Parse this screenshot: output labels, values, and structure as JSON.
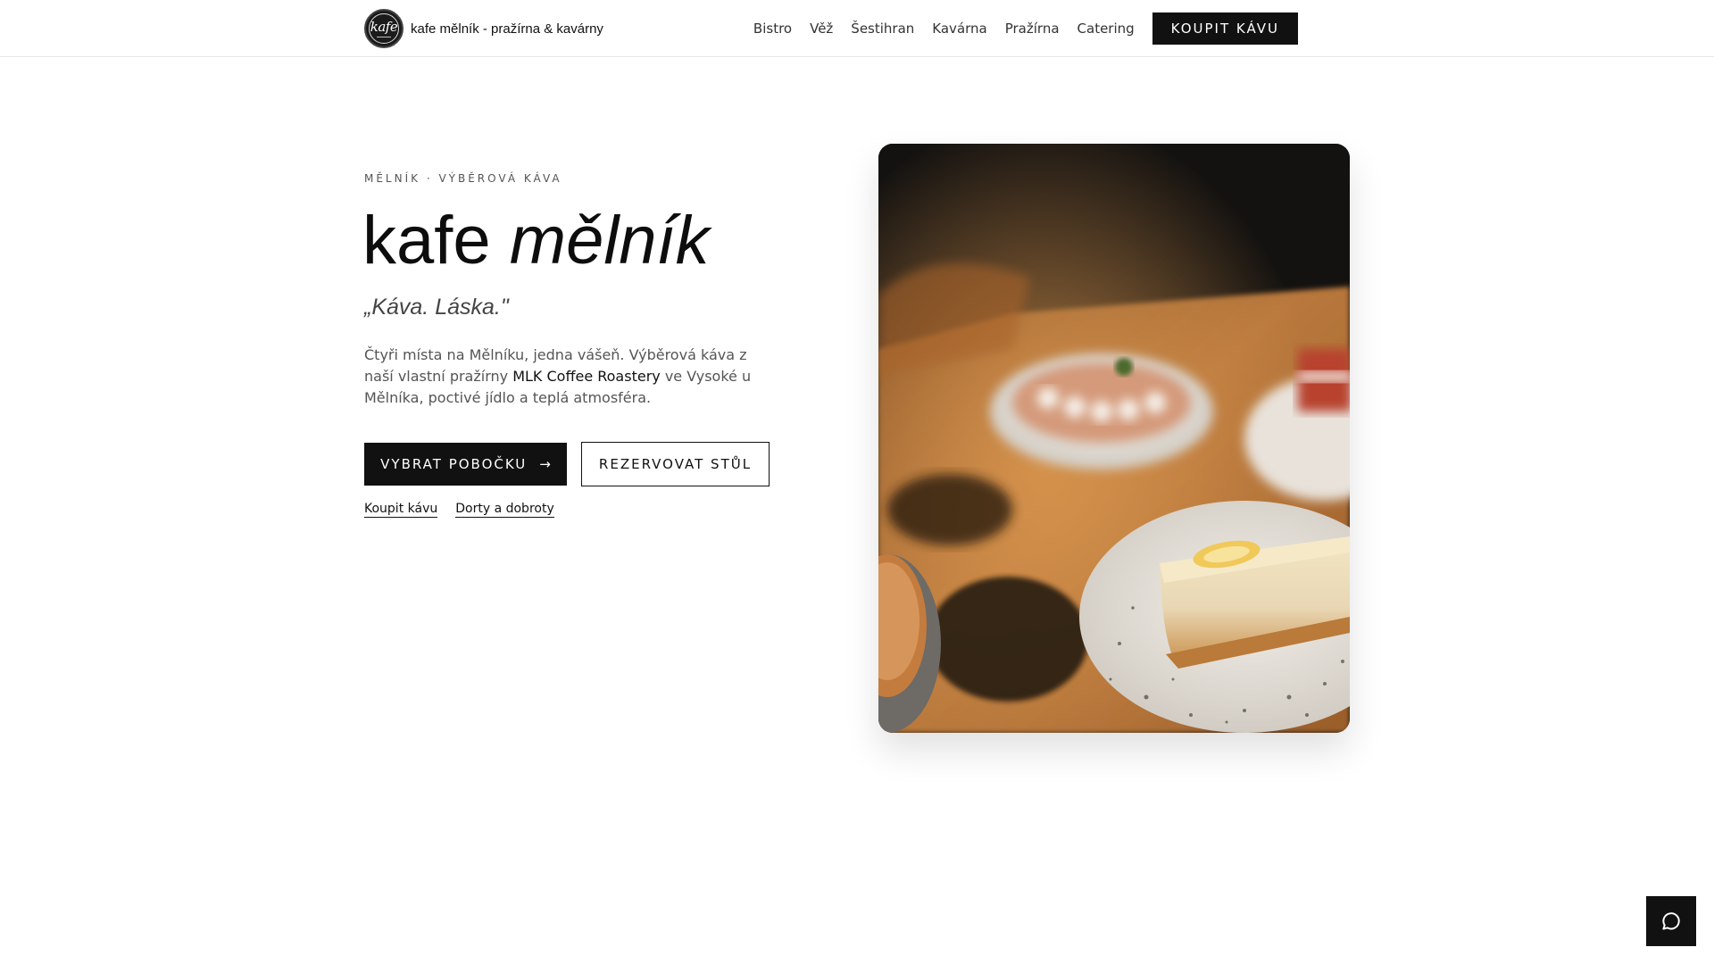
{
  "header": {
    "brand_name": "kafe mělník - pražírna & kavárny",
    "logo_text": "kafe",
    "nav": [
      {
        "label": "Bistro"
      },
      {
        "label": "Věž"
      },
      {
        "label": "Šestihran"
      },
      {
        "label": "Kavárna"
      },
      {
        "label": "Pražírna"
      },
      {
        "label": "Catering"
      }
    ],
    "cta_label": "KOUPIT KÁVU"
  },
  "hero": {
    "eyebrow": "MĚLNÍK · VÝBĚROVÁ KÁVA",
    "title_plain": "kafe ",
    "title_italic": "mělník",
    "tagline": "„Káva. Láska.\"",
    "lead_before": "Čtyři místa na Mělníku, jedna vášeň. Výběrová káva z naší vlastní pražírny ",
    "lead_link": "MLK Coffee Roastery",
    "lead_after": " ve Vysoké u Mělníka, poctivé jídlo a teplá atmosféra.",
    "primary_button": "VYBRAT POBOČKU",
    "primary_arrow": "→",
    "secondary_button": "REZERVOVAT STŮL",
    "links": [
      {
        "label": "Koupit kávu"
      },
      {
        "label": "Dorty a dobroty"
      }
    ]
  },
  "icons": {
    "chat": "chat-bubble-icon",
    "arrow": "arrow-right-icon"
  },
  "colors": {
    "primary": "#111111",
    "background": "#ffffff",
    "muted_text": "#555555"
  }
}
